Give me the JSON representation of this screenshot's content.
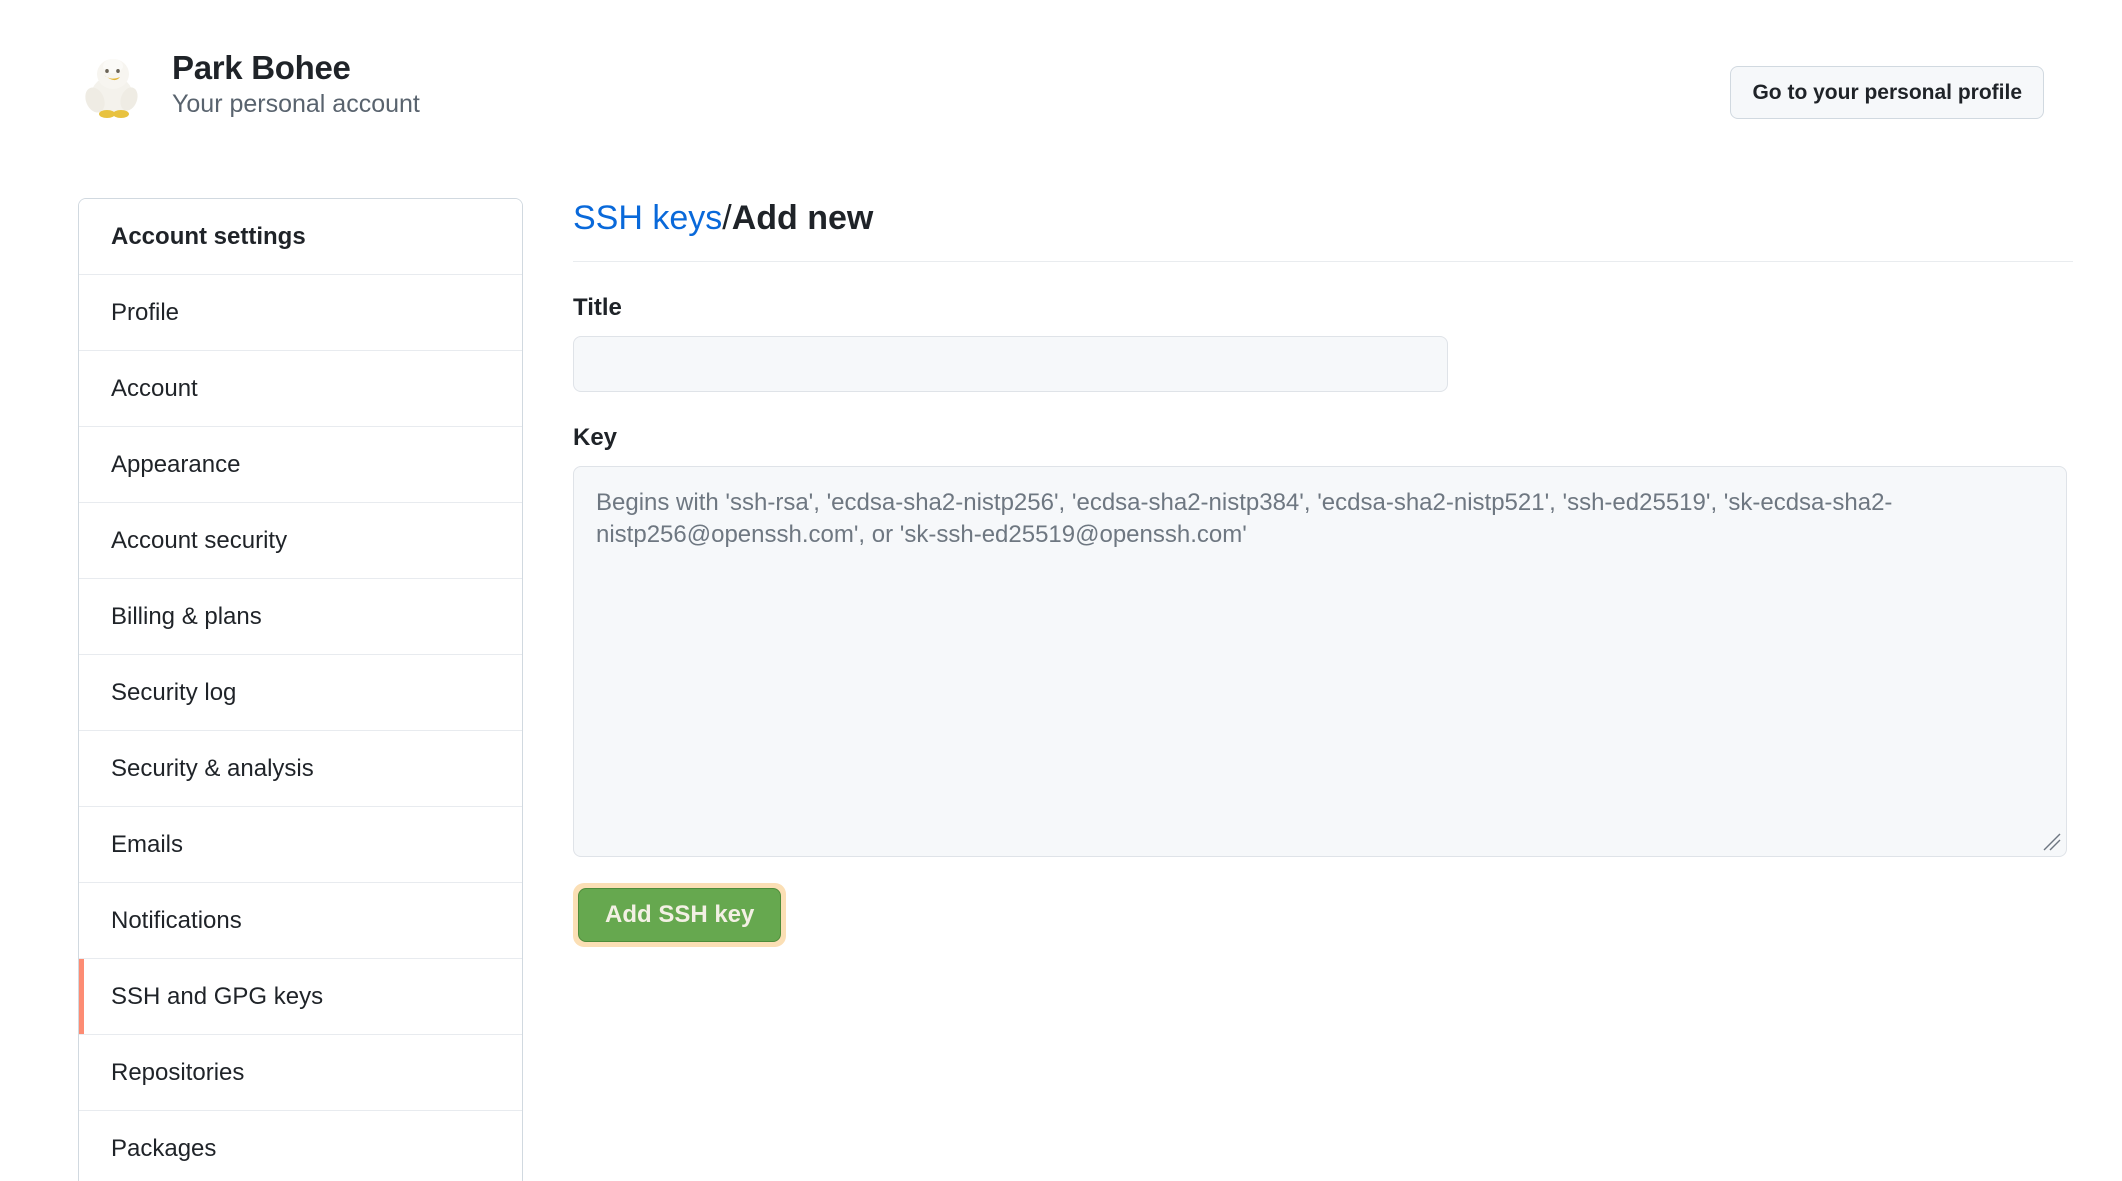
{
  "header": {
    "avatar_alt": "plush-duck-avatar",
    "account_name": "Park Bohee",
    "account_subtitle": "Your personal account",
    "profile_button": "Go to your personal profile"
  },
  "sidebar": {
    "items": [
      {
        "label": "Account settings",
        "heading": true,
        "active": false
      },
      {
        "label": "Profile",
        "heading": false,
        "active": false
      },
      {
        "label": "Account",
        "heading": false,
        "active": false
      },
      {
        "label": "Appearance",
        "heading": false,
        "active": false
      },
      {
        "label": "Account security",
        "heading": false,
        "active": false
      },
      {
        "label": "Billing & plans",
        "heading": false,
        "active": false
      },
      {
        "label": "Security log",
        "heading": false,
        "active": false
      },
      {
        "label": "Security & analysis",
        "heading": false,
        "active": false
      },
      {
        "label": "Emails",
        "heading": false,
        "active": false
      },
      {
        "label": "Notifications",
        "heading": false,
        "active": false
      },
      {
        "label": "SSH and GPG keys",
        "heading": false,
        "active": true
      },
      {
        "label": "Repositories",
        "heading": false,
        "active": false
      },
      {
        "label": "Packages",
        "heading": false,
        "active": false
      }
    ]
  },
  "main": {
    "breadcrumb_link": "SSH keys",
    "breadcrumb_separator": "/",
    "breadcrumb_current": "Add new",
    "title_field": {
      "label": "Title",
      "value": "",
      "placeholder": ""
    },
    "key_field": {
      "label": "Key",
      "value": "",
      "placeholder": "Begins with 'ssh-rsa', 'ecdsa-sha2-nistp256', 'ecdsa-sha2-nistp384', 'ecdsa-sha2-nistp521', 'ssh-ed25519', 'sk-ecdsa-sha2-nistp256@openssh.com', or 'sk-ssh-ed25519@openssh.com'"
    },
    "submit_button": "Add SSH key"
  },
  "colors": {
    "link_blue": "#0969da",
    "active_accent": "#fd8c73",
    "button_green": "#66a84f",
    "focus_ring": "#fbdfb5",
    "input_bg": "#f6f8fa",
    "border": "#d1d9e0",
    "muted_text": "#59636e"
  }
}
